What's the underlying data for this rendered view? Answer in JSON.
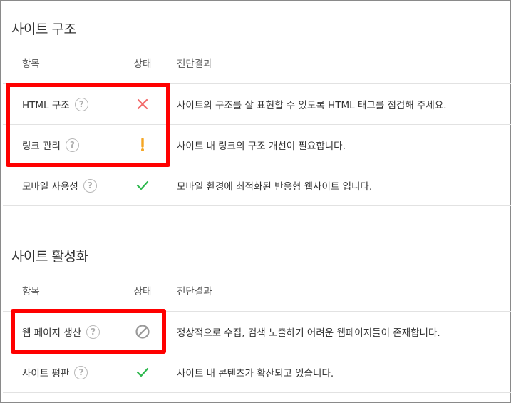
{
  "sections": [
    {
      "title": "사이트 구조",
      "headers": {
        "item": "항목",
        "status": "상태",
        "result": "진단결과"
      },
      "rows": [
        {
          "item": "HTML 구조",
          "status": "fail",
          "result": "사이트의 구조를 잘 표현할 수 있도록 HTML 태그를 점검해 주세요."
        },
        {
          "item": "링크 관리",
          "status": "warning",
          "result": "사이트 내 링크의 구조 개선이 필요합니다."
        },
        {
          "item": "모바일 사용성",
          "status": "pass",
          "result": "모바일 환경에 최적화된 반응형 웹사이트 입니다."
        }
      ]
    },
    {
      "title": "사이트 활성화",
      "headers": {
        "item": "항목",
        "status": "상태",
        "result": "진단결과"
      },
      "rows": [
        {
          "item": "웹 페이지 생산",
          "status": "blocked",
          "result": "정상적으로 수집, 검색 노출하기 어려운 웹페이지들이 존재합니다."
        },
        {
          "item": "사이트 평판",
          "status": "pass",
          "result": "사이트 내 콘텐츠가 확산되고 있습니다."
        }
      ]
    }
  ],
  "help_glyph": "?",
  "icons": {
    "fail": "x-icon",
    "warning": "exclamation-icon",
    "pass": "check-icon",
    "blocked": "prohibited-icon",
    "help": "help-icon"
  },
  "colors": {
    "fail": "#f26b6b",
    "warning": "#f5a623",
    "pass": "#2db84d",
    "blocked": "#9a9a9a",
    "highlight": "#ff0000"
  }
}
